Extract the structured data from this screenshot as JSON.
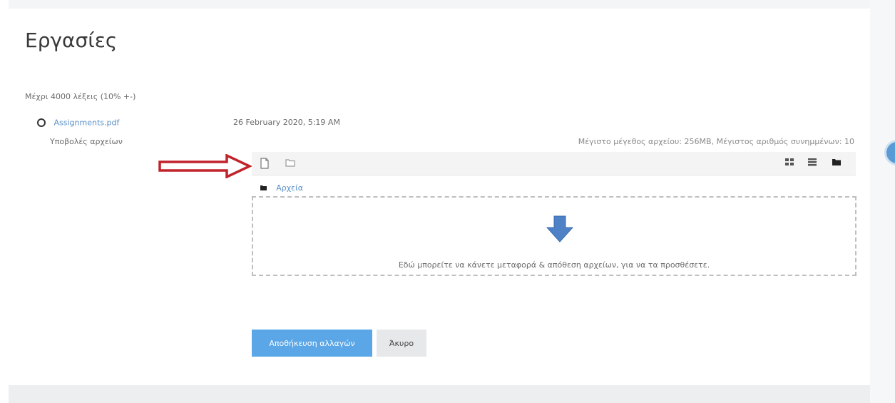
{
  "page": {
    "title": "Εργασίες",
    "word_limit": "Μέχρι 4000 λέξεις (10% +-)"
  },
  "submission": {
    "file_name": "Assignments.pdf",
    "date": "26 February 2020, 5:19 AM",
    "field_label": "Υποβολές αρχείων",
    "limits": "Μέγιστο μέγεθος αρχείου: 256MB, Μέγιστος αριθμός συνημμένων: 10"
  },
  "filepicker": {
    "add_icon": "file-add-icon",
    "new_folder_icon": "folder-create-icon",
    "path_label": "Αρχεία",
    "drop_text": "Εδώ μπορείτε να κάνετε μεταφορά & απόθεση αρχείων, για να τα προσθέσετε.",
    "view_icons": [
      "grid-view-icon",
      "list-view-icon",
      "tree-view-icon"
    ],
    "arrow_color": "#4f81c7"
  },
  "annotation": {
    "arrow_color": "#c0242b"
  },
  "buttons": {
    "submit": "Αποθήκευση αλλαγών",
    "cancel": "Άκυρο",
    "submit_color": "#5aa6e6"
  }
}
